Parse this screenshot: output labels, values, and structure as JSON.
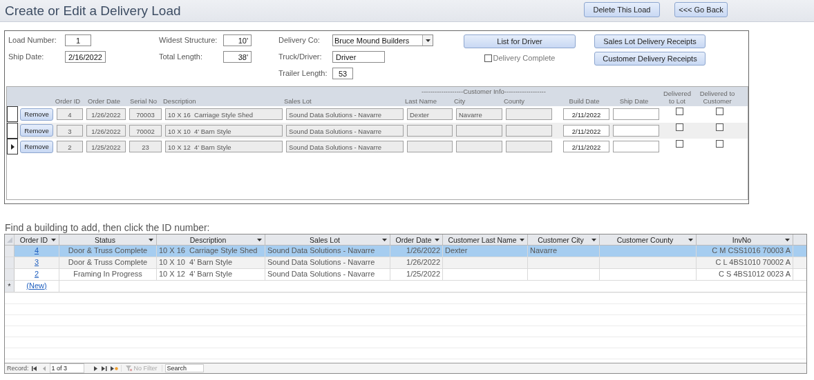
{
  "title": "Create or Edit a Delivery Load",
  "header_buttons": [
    "Delete This Load",
    "<<< Go Back"
  ],
  "load_fields": [
    {
      "label": "Load Number:",
      "value": "1"
    },
    {
      "label": "Ship Date:",
      "value": "2/16/2022"
    }
  ],
  "size_fields": [
    {
      "label": "Widest Structure:",
      "value": "10'"
    },
    {
      "label": "Total Length:",
      "value": "38'"
    }
  ],
  "delivery_fields": [
    {
      "label": "Delivery Co:",
      "value": "Bruce Mound Builders",
      "kind": "dropdown"
    },
    {
      "label": "Truck/Driver:",
      "value": "Driver",
      "kind": "text"
    },
    {
      "label": "Trailer Length:",
      "value": "53",
      "kind": "number"
    }
  ],
  "list_button": "List for Driver",
  "delivery_complete": {
    "label": "Delivery Complete",
    "checked": false
  },
  "receipt_buttons": [
    "Sales Lot Delivery Receipts",
    "Customer Delivery Receipts"
  ],
  "load_items": {
    "group_heading": "-------------------Customer Info-------------------",
    "columns": [
      "Order ID",
      "Order Date",
      "Serial No",
      "Description",
      "Sales Lot",
      "Last Name",
      "City",
      "County",
      "Build Date",
      "Ship Date",
      "Delivered to Lot",
      "Delivered to Customer"
    ],
    "rows": [
      {
        "button": "Remove",
        "current": false,
        "order_id": "4",
        "order_date": "1/26/2022",
        "serial_no": "70003",
        "description": "10 X 16  Carriage Style Shed",
        "sales_lot": "Sound Data Solutions - Navarre",
        "last_name": "Dexter",
        "city": "Navarre",
        "build_date": "2/11/2022",
        "delivered_to_lot": false,
        "delivered_to_customer": false
      },
      {
        "button": "Remove",
        "current": false,
        "order_id": "3",
        "order_date": "1/26/2022",
        "serial_no": "70002",
        "description": "10 X 10  4' Barn Style",
        "sales_lot": "Sound Data Solutions - Navarre",
        "build_date": "2/11/2022",
        "delivered_to_lot": false,
        "delivered_to_customer": false
      },
      {
        "button": "Remove",
        "current": true,
        "order_id": "2",
        "order_date": "1/25/2022",
        "serial_no": "23",
        "description": "10 X 12  4' Barn Style",
        "sales_lot": "Sound Data Solutions - Navarre",
        "build_date": "2/11/2022",
        "delivered_to_lot": false,
        "delivered_to_customer": false
      }
    ]
  },
  "find_prompt": "Find a building to add, then click the ID number:",
  "datasheet": {
    "columns": [
      "Order ID",
      "Status",
      "Description",
      "Sales Lot",
      "Order Date",
      "Customer Last Name",
      "Customer City",
      "Customer County",
      "InvNo"
    ],
    "rows": [
      {
        "selected": true,
        "order_id": "4",
        "status": "Door & Truss Complete",
        "description": "10 X 16  Carriage Style Shed",
        "sales_lot": "Sound Data Solutions - Navarre",
        "order_date": "1/26/2022",
        "last_name": "Dexter",
        "city": "Navarre",
        "inv_no": "C M CSS1016 70003 A"
      },
      {
        "selected": false,
        "order_id": "3",
        "status": "Door & Truss Complete",
        "description": "10 X 10  4' Barn Style",
        "sales_lot": "Sound Data Solutions - Navarre",
        "order_date": "1/26/2022",
        "inv_no": "C L 4BS1010 70002 A"
      },
      {
        "selected": false,
        "order_id": "2",
        "status": "Framing In Progress",
        "description": "10 X 12  4' Barn Style",
        "sales_lot": "Sound Data Solutions - Navarre",
        "order_date": "1/25/2022",
        "inv_no": "C S 4BS1012 0023 A"
      }
    ],
    "new_row": {
      "marker": "*",
      "label": "(New)"
    }
  },
  "record_nav": {
    "label": "Record:",
    "position": "1 of 3",
    "filter": "No Filter",
    "search": {
      "placeholder": "Search"
    }
  }
}
